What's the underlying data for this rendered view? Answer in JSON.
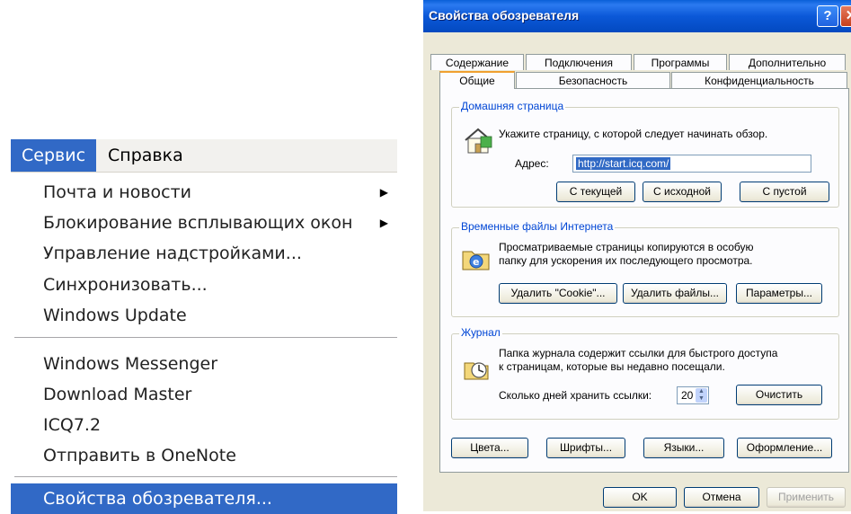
{
  "menu": {
    "menubar": {
      "active": "Сервис",
      "help": "Справка"
    },
    "items": [
      {
        "label": "Почта и новости",
        "submenu": true
      },
      {
        "label": "Блокирование всплывающих окон",
        "submenu": true
      },
      {
        "label": "Управление надстройками..."
      },
      {
        "label": "Синхронизовать..."
      },
      {
        "label": "Windows Update"
      },
      {
        "label": "Windows Messenger"
      },
      {
        "label": "Download Master"
      },
      {
        "label": "ICQ7.2"
      },
      {
        "label": "Отправить в OneNote"
      },
      {
        "label": "Свойства обозревателя...",
        "highlighted": true
      }
    ],
    "submenu_arrow": "▶"
  },
  "dialog": {
    "title": "Свойства обозревателя",
    "help_glyph": "?",
    "close_glyph": "✕",
    "tabs_row1": [
      "Содержание",
      "Подключения",
      "Программы",
      "Дополнительно"
    ],
    "tabs_row2": [
      "Общие",
      "Безопасность",
      "Конфиденциальность"
    ],
    "selected_tab": "Общие",
    "home": {
      "label": "Домашняя страница",
      "desc": "Укажите страницу, с которой следует начинать обзор.",
      "addr_label": "Адрес:",
      "addr_value": "http://start.icq.com/",
      "btn_current": "С текущей",
      "btn_default": "С исходной",
      "btn_blank": "С пустой"
    },
    "temp": {
      "label": "Временные файлы Интернета",
      "desc1": "Просматриваемые страницы копируются в особую",
      "desc2": "папку для ускорения их последующего просмотра.",
      "btn_cookies": "Удалить \"Cookie\"...",
      "btn_files": "Удалить файлы...",
      "btn_settings": "Параметры..."
    },
    "history": {
      "label": "Журнал",
      "desc1": "Папка журнала содержит ссылки для быстрого доступа",
      "desc2": "к страницам, которые вы недавно посещали.",
      "days_label": "Сколько дней хранить ссылки:",
      "days_value": "20",
      "btn_clear": "Очистить"
    },
    "bottom": {
      "colors": "Цвета...",
      "fonts": "Шрифты...",
      "languages": "Языки...",
      "appearance": "Оформление..."
    },
    "footer": {
      "ok": "OK",
      "cancel": "Отмена",
      "apply": "Применить"
    }
  }
}
